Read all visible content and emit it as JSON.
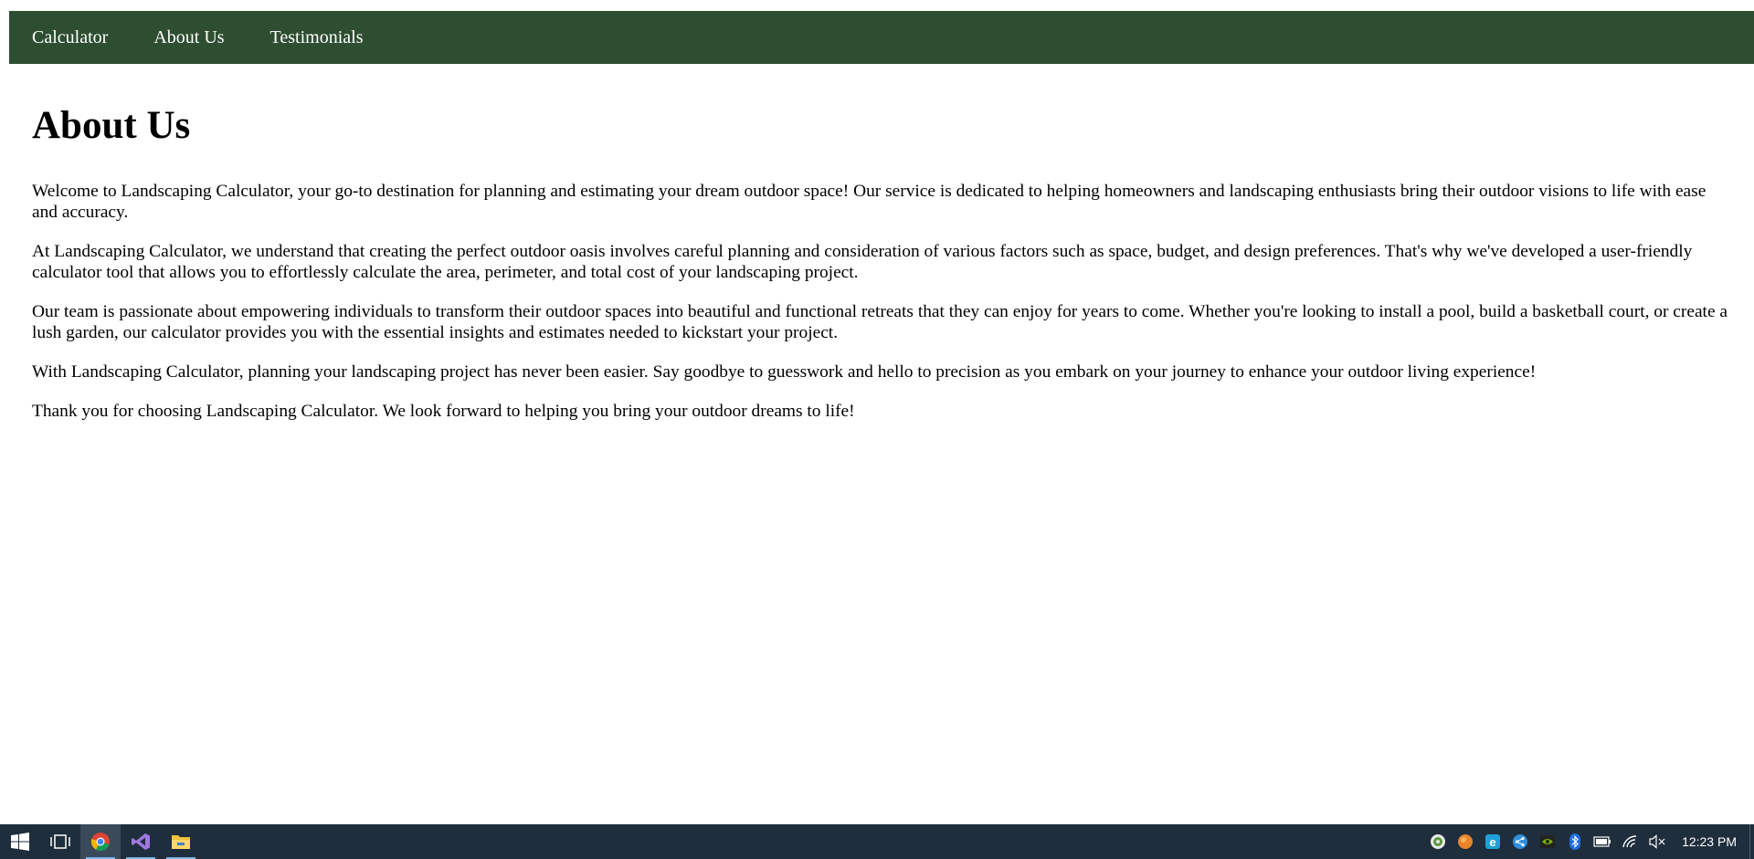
{
  "nav": {
    "items": [
      {
        "label": "Calculator"
      },
      {
        "label": "About Us"
      },
      {
        "label": "Testimonials"
      }
    ],
    "background_color": "#2e4e31"
  },
  "page": {
    "title": "About Us",
    "paragraphs": [
      "Welcome to Landscaping Calculator, your go-to destination for planning and estimating your dream outdoor space! Our service is dedicated to helping homeowners and landscaping enthusiasts bring their outdoor visions to life with ease and accuracy.",
      "At Landscaping Calculator, we understand that creating the perfect outdoor oasis involves careful planning and consideration of various factors such as space, budget, and design preferences. That's why we've developed a user-friendly calculator tool that allows you to effortlessly calculate the area, perimeter, and total cost of your landscaping project.",
      "Our team is passionate about empowering individuals to transform their outdoor spaces into beautiful and functional retreats that they can enjoy for years to come. Whether you're looking to install a pool, build a basketball court, or create a lush garden, our calculator provides you with the essential insights and estimates needed to kickstart your project.",
      "With Landscaping Calculator, planning your landscaping project has never been easier. Say goodbye to guesswork and hello to precision as you embark on your journey to enhance your outdoor living experience!",
      "Thank you for choosing Landscaping Calculator. We look forward to helping you bring your outdoor dreams to life!"
    ]
  },
  "taskbar": {
    "apps": [
      {
        "icon": "windows-start-icon"
      },
      {
        "icon": "task-view-icon"
      },
      {
        "icon": "chrome-icon",
        "active": true
      },
      {
        "icon": "visual-studio-icon",
        "running": true
      },
      {
        "icon": "file-explorer-icon",
        "running": true
      }
    ],
    "tray_icons": [
      "app-tray-icon",
      "orange-tray-icon",
      "edge-tray-icon",
      "share-tray-icon",
      "nvidia-tray-icon",
      "bluetooth-icon",
      "battery-icon",
      "wifi-icon",
      "volume-muted-icon"
    ],
    "clock": "12:23 PM"
  }
}
